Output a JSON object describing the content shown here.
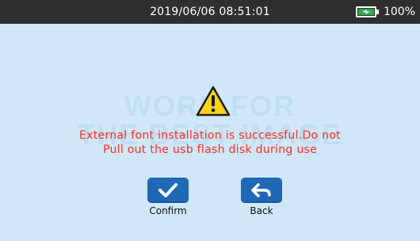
{
  "status_bar": {
    "datetime": "2019/06/06 08:51:01",
    "battery_percent": "100%",
    "battery_icon": "battery-charging-icon",
    "battery_level": 1.0
  },
  "dialog": {
    "warning_icon": "warning-triangle-icon",
    "message_line1": "External font installation is successful.Do not",
    "message_line2": "Pull out the usb flash disk during use",
    "watermark_line1": "WORK FOR",
    "watermark_line2": "THE BEST IMAGE"
  },
  "buttons": {
    "confirm_label": "Confirm",
    "confirm_icon": "checkmark-icon",
    "back_label": "Back",
    "back_icon": "back-arrow-icon"
  },
  "colors": {
    "background": "#cfe7f7",
    "status_bar": "#2f2f2f",
    "message_text": "#ff2a1f",
    "button": "#1f68b4",
    "warning_fill": "#ffd21a"
  }
}
